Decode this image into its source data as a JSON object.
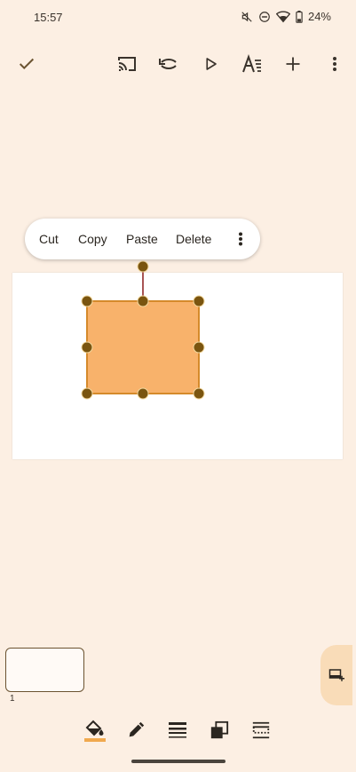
{
  "status": {
    "time": "15:57",
    "battery": "24%",
    "icons": [
      "mute-icon",
      "dnd-icon",
      "wifi-icon",
      "battery-icon"
    ]
  },
  "toolbar": {
    "buttons": [
      "check-icon",
      "cast-icon",
      "undo-icon",
      "play-icon",
      "text-format-icon",
      "add-icon",
      "more-vert-icon"
    ]
  },
  "context_menu": {
    "items": [
      "Cut",
      "Copy",
      "Paste",
      "Delete"
    ]
  },
  "slide": {
    "shape_fill": "#f8b26b",
    "shape_border": "#d58a2b",
    "handle_color": "#7a5510",
    "rotation_line_color": "#8b1a1a"
  },
  "thumbnails": [
    {
      "number": "1"
    }
  ],
  "bottom_tools": [
    "fill-color-icon",
    "line-color-icon",
    "line-weight-icon",
    "arrange-icon",
    "crop-layout-icon"
  ],
  "colors": {
    "background": "#fcefe3",
    "accent": "#f9dcb8",
    "fill_underline": "#f0a94e"
  }
}
